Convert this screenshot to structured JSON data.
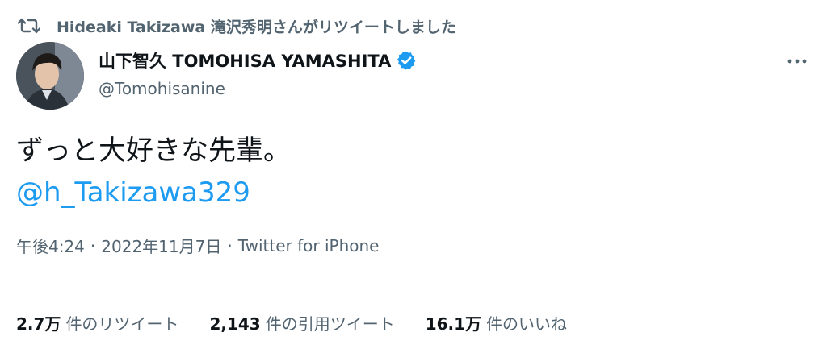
{
  "retweet": {
    "icon": "retweet-icon",
    "text": "Hideaki Takizawa 滝沢秀明さんがリツイートしました"
  },
  "author": {
    "avatar": "avatar-photo",
    "display_name": "山下智久 TOMOHISA YAMASHITA",
    "verified_icon": "verified-badge-icon",
    "handle": "@Tomohisanine"
  },
  "more_icon": "more-options-icon",
  "tweet": {
    "text": "ずっと大好きな先輩。",
    "mention": "@h_Takizawa329"
  },
  "meta": {
    "time": "午後4:24",
    "separator": "·",
    "date": "2022年11月7日",
    "source": "Twitter for iPhone"
  },
  "stats": [
    {
      "value": "2.7万",
      "label": "件のリツイート"
    },
    {
      "value": "2,143",
      "label": "件の引用ツイート"
    },
    {
      "value": "16.1万",
      "label": "件のいいね"
    }
  ],
  "colors": {
    "accent": "#1d9bf0",
    "secondary_text": "#536471",
    "primary_text": "#0f1419"
  }
}
